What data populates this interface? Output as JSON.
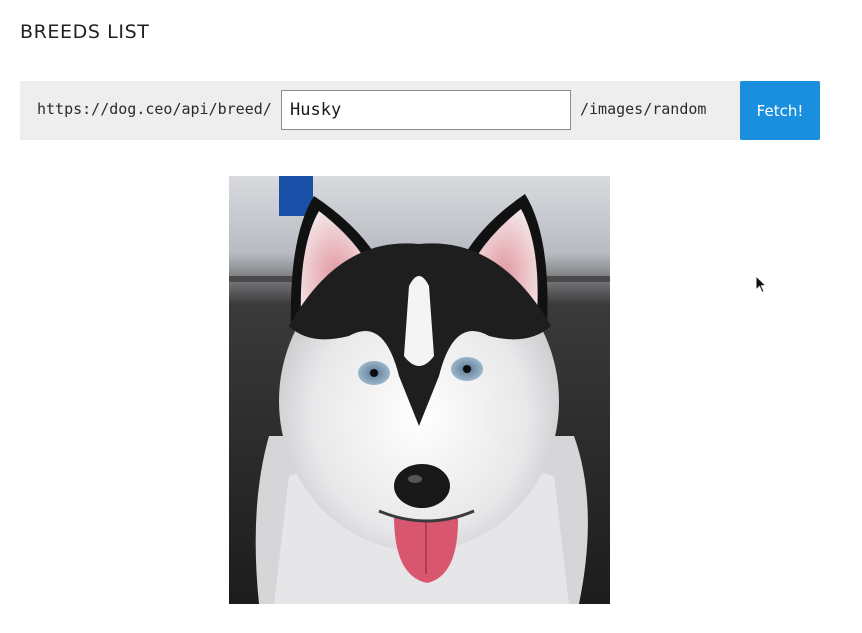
{
  "header": {
    "title": "BREEDS LIST"
  },
  "url_builder": {
    "prefix": "https://dog.ceo/api/breed/",
    "breed_value": "Husky",
    "suffix": "/images/random",
    "fetch_label": "Fetch!"
  },
  "result": {
    "image_subject": "husky-dog-photo"
  },
  "colors": {
    "accent": "#1a8fdd",
    "bar_background": "#eeeeee"
  }
}
